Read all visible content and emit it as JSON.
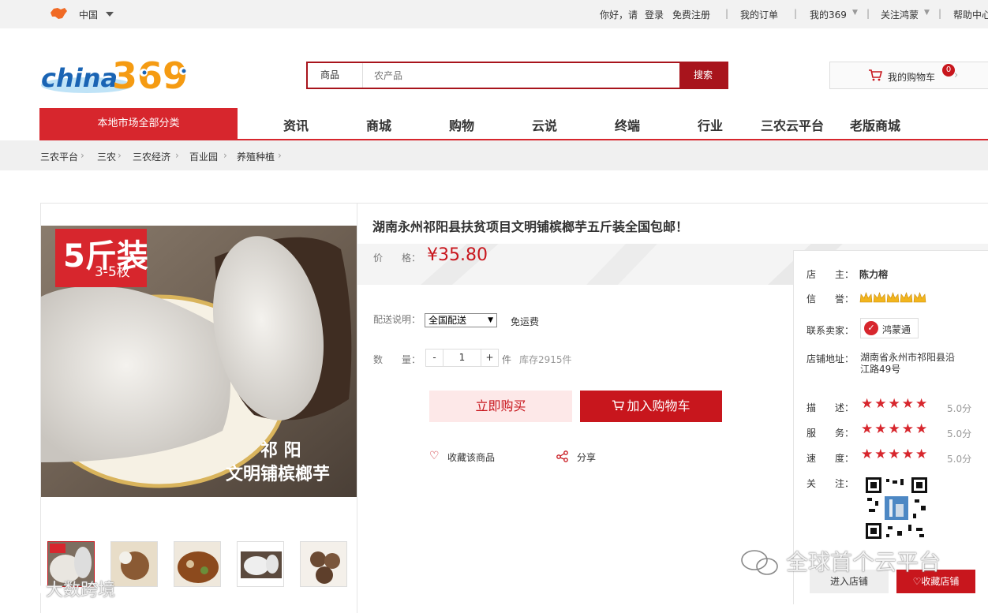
{
  "topbar": {
    "region": "中国",
    "greeting": "你好，请",
    "login": "登录",
    "register": "免费注册",
    "orders": "我的订单",
    "my369": "我的369",
    "follow": "关注鸿蒙",
    "help": "帮助中心",
    "sep": "|"
  },
  "logo": {
    "text_a": "china",
    "text_b": "369"
  },
  "search": {
    "category": "商品",
    "placeholder": "农产品",
    "button": "搜索"
  },
  "cart": {
    "label": "我的购物车",
    "count": "0"
  },
  "nav": {
    "all_categories": "本地市场全部分类",
    "items": [
      "资讯",
      "商城",
      "购物",
      "云说",
      "终端",
      "行业",
      "三农云平台",
      "老版商城"
    ]
  },
  "breadcrumb": [
    "三农平台",
    "三农",
    "三农经济",
    "百业园",
    "养殖种植"
  ],
  "product": {
    "title": "湖南永州祁阳县扶贫项目文明铺槟榔芋五斤装全国包邮！",
    "price_label": "价　　格：",
    "price": "¥35.80",
    "shipping_label": "配送说明：",
    "shipping_option": "全国配送",
    "shipping_fee": "免运费",
    "qty_label": "数　　量：",
    "qty_minus": "-",
    "qty_value": "1",
    "qty_plus": "+",
    "qty_unit": "件",
    "stock": "库存2915件",
    "buy_now": "立即购买",
    "add_cart": "加入购物车",
    "collect": "收藏该商品",
    "share": "分享",
    "image_badge_big": "5斤装",
    "image_badge_small": "3-5枚",
    "image_caption_1": "祁 阳",
    "image_caption_2": "文明铺槟榔芋"
  },
  "seller": {
    "owner_label": "店　　主：",
    "owner": "陈力榕",
    "credit_label": "信　　誉：",
    "contact_label": "联系卖家：",
    "contact_app": "鸿蒙通",
    "address_label": "店铺地址：",
    "address": "湖南省永州市祁阳县沿江路49号",
    "ratings": [
      {
        "label": "描　　述：",
        "stars": "★★★★★",
        "score": "5.0分"
      },
      {
        "label": "服　　务：",
        "stars": "★★★★★",
        "score": "5.0分"
      },
      {
        "label": "速　　度：",
        "stars": "★★★★★",
        "score": "5.0分"
      }
    ],
    "follow_label": "关　　注：",
    "enter_store": "进入店铺",
    "fav_store": "收藏店铺"
  },
  "watermarks": {
    "wechat": "全球首个云平台",
    "logo": "大数跨境"
  },
  "colors": {
    "brand_red": "#c8161d",
    "nav_red": "#d7262d",
    "search_red": "#a8141c"
  }
}
